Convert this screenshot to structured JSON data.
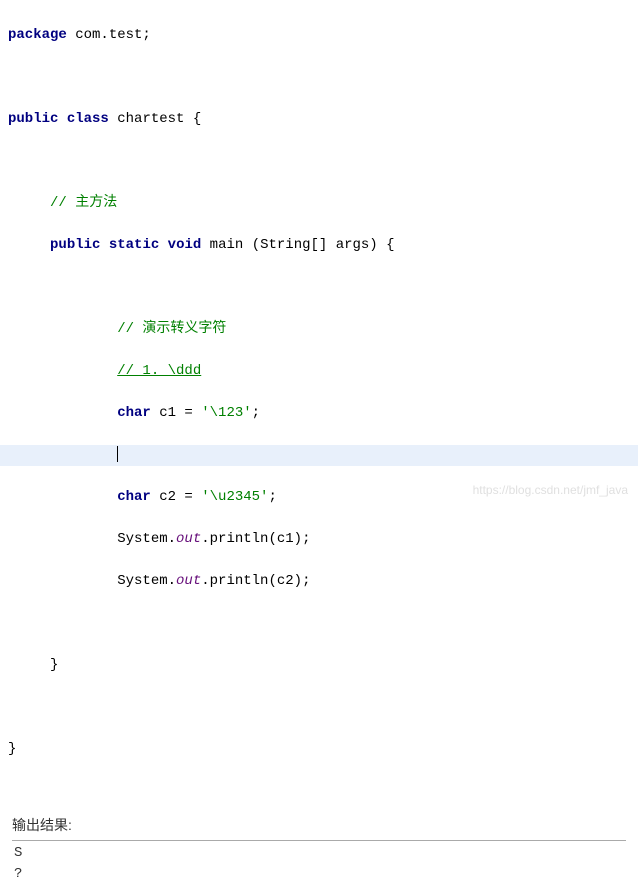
{
  "code": {
    "l1_kw1": "package",
    "l1_rest": " com.test;",
    "l3_kw1": "public",
    "l3_kw2": "class",
    "l3_rest": " chartest {",
    "l5_indent": "     ",
    "l5_comment": "// 主方法",
    "l6_indent": "     ",
    "l6_kw1": "public",
    "l6_kw2": "static",
    "l6_kw3": "void",
    "l6_rest": " main (String[] args) {",
    "l8_indent": "             ",
    "l8_comment": "// 演示转义字符",
    "l9_indent": "             ",
    "l9_comment": "// 1. \\ddd",
    "l10_indent": "             ",
    "l10_kw": "char",
    "l10_mid": " c1 = ",
    "l10_str": "'\\123'",
    "l10_end": ";",
    "l11_indent": "             ",
    "l12_indent": "             ",
    "l12_kw": "char",
    "l12_mid": " c2 = ",
    "l12_str": "'\\u2345'",
    "l12_end": ";",
    "l13_indent": "             ",
    "l13_p1": "System.",
    "l13_field": "out",
    "l13_p2": ".println(c1);",
    "l14_indent": "             ",
    "l14_p1": "System.",
    "l14_field": "out",
    "l14_p2": ".println(c2);",
    "l16_indent": "     ",
    "l16_brace": "}",
    "l18_brace": "}"
  },
  "output": {
    "label": "输出结果:",
    "line1": "S",
    "line2": "?"
  },
  "watermark": "https://blog.csdn.net/jmf_java"
}
